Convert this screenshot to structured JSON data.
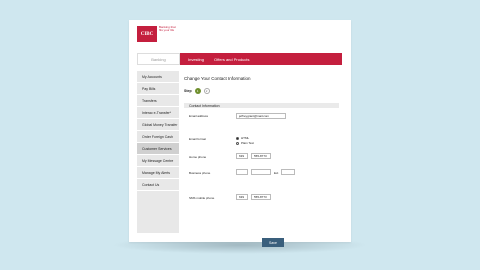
{
  "brand": {
    "logo_text": "CIBC",
    "tagline": "Banking that fits your life"
  },
  "topnav": {
    "banking": "Banking",
    "investing": "Investing",
    "offers": "Offers and Products"
  },
  "sidebar": {
    "items": [
      {
        "label": "My Accounts"
      },
      {
        "label": "Pay Bills"
      },
      {
        "label": "Transfers"
      },
      {
        "label": "Interac e-Transfer*"
      },
      {
        "label": "Global Money Transfer"
      },
      {
        "label": "Order Foreign Cash"
      },
      {
        "label": "Customer Services"
      },
      {
        "label": "My Message Centre"
      },
      {
        "label": "Manage My Alerts"
      },
      {
        "label": "Contact Us"
      }
    ]
  },
  "page": {
    "title": "Change Your Contact Information",
    "step_label": "Step",
    "step1": "1",
    "step2": "2",
    "section_title": "Contact Information"
  },
  "form": {
    "email_label": "Email address",
    "email_value": "jeffreygrant@mail.com",
    "format_label": "Email format",
    "format_html": "HTML",
    "format_plain": "Plain Text",
    "home_label": "Home phone",
    "home_area": "639",
    "home_number": "555-8773",
    "business_label": "Business phone",
    "ext_label": "Ext",
    "sms_label": "SMS mobile phone",
    "sms_area": "639",
    "sms_number": "555-8773"
  },
  "actions": {
    "save": "Save"
  }
}
